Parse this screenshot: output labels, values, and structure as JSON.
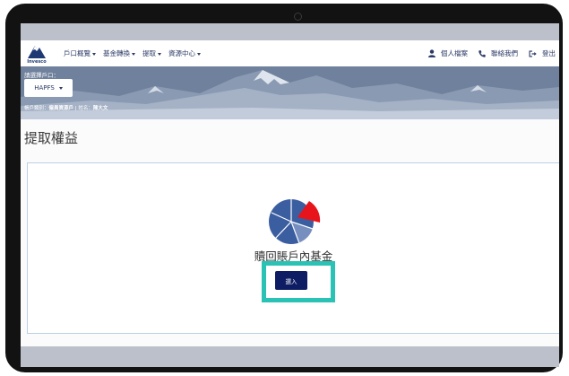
{
  "brand": {
    "name": "Invesco"
  },
  "nav": {
    "menu": [
      {
        "label": "戶口概覽"
      },
      {
        "label": "基金轉換"
      },
      {
        "label": "提取"
      },
      {
        "label": "資源中心"
      }
    ],
    "links": [
      {
        "label": "個人檔案",
        "icon": "user-icon"
      },
      {
        "label": "聯絡我們",
        "icon": "phone-icon"
      },
      {
        "label": "登出",
        "icon": "logout-icon"
      }
    ]
  },
  "account": {
    "prompt": "請選擇戶口：",
    "selected": "HAPFS",
    "info_label": "帳戶類別：",
    "info_value": "僱員資源戶",
    "name_label": "姓名：",
    "name_value": "陳大文"
  },
  "page": {
    "title": "提取權益"
  },
  "option": {
    "label": "贖回賬戶內基金",
    "button_label": "選入",
    "icon": "pie-chart-icon"
  },
  "colors": {
    "navy": "#0e1d63",
    "highlight": "#29c2b5",
    "pie_blue": "#3b5ea1",
    "pie_red": "#e8141c"
  }
}
